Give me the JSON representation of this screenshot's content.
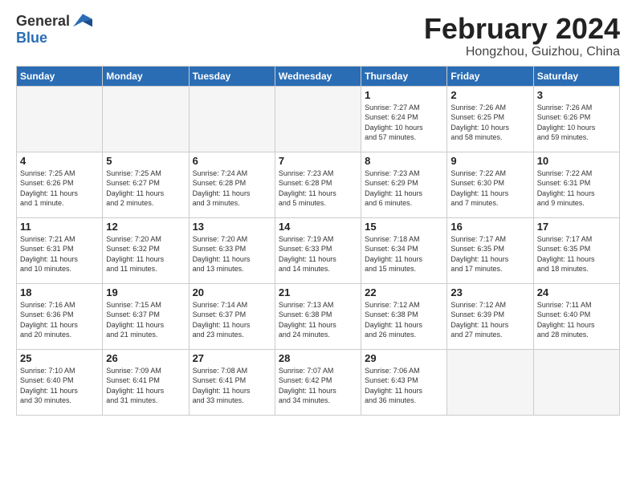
{
  "header": {
    "logo_general": "General",
    "logo_blue": "Blue",
    "month_title": "February 2024",
    "location": "Hongzhou, Guizhou, China"
  },
  "days_of_week": [
    "Sunday",
    "Monday",
    "Tuesday",
    "Wednesday",
    "Thursday",
    "Friday",
    "Saturday"
  ],
  "weeks": [
    [
      {
        "day": "",
        "info": ""
      },
      {
        "day": "",
        "info": ""
      },
      {
        "day": "",
        "info": ""
      },
      {
        "day": "",
        "info": ""
      },
      {
        "day": "1",
        "info": "Sunrise: 7:27 AM\nSunset: 6:24 PM\nDaylight: 10 hours\nand 57 minutes."
      },
      {
        "day": "2",
        "info": "Sunrise: 7:26 AM\nSunset: 6:25 PM\nDaylight: 10 hours\nand 58 minutes."
      },
      {
        "day": "3",
        "info": "Sunrise: 7:26 AM\nSunset: 6:26 PM\nDaylight: 10 hours\nand 59 minutes."
      }
    ],
    [
      {
        "day": "4",
        "info": "Sunrise: 7:25 AM\nSunset: 6:26 PM\nDaylight: 11 hours\nand 1 minute."
      },
      {
        "day": "5",
        "info": "Sunrise: 7:25 AM\nSunset: 6:27 PM\nDaylight: 11 hours\nand 2 minutes."
      },
      {
        "day": "6",
        "info": "Sunrise: 7:24 AM\nSunset: 6:28 PM\nDaylight: 11 hours\nand 3 minutes."
      },
      {
        "day": "7",
        "info": "Sunrise: 7:23 AM\nSunset: 6:28 PM\nDaylight: 11 hours\nand 5 minutes."
      },
      {
        "day": "8",
        "info": "Sunrise: 7:23 AM\nSunset: 6:29 PM\nDaylight: 11 hours\nand 6 minutes."
      },
      {
        "day": "9",
        "info": "Sunrise: 7:22 AM\nSunset: 6:30 PM\nDaylight: 11 hours\nand 7 minutes."
      },
      {
        "day": "10",
        "info": "Sunrise: 7:22 AM\nSunset: 6:31 PM\nDaylight: 11 hours\nand 9 minutes."
      }
    ],
    [
      {
        "day": "11",
        "info": "Sunrise: 7:21 AM\nSunset: 6:31 PM\nDaylight: 11 hours\nand 10 minutes."
      },
      {
        "day": "12",
        "info": "Sunrise: 7:20 AM\nSunset: 6:32 PM\nDaylight: 11 hours\nand 11 minutes."
      },
      {
        "day": "13",
        "info": "Sunrise: 7:20 AM\nSunset: 6:33 PM\nDaylight: 11 hours\nand 13 minutes."
      },
      {
        "day": "14",
        "info": "Sunrise: 7:19 AM\nSunset: 6:33 PM\nDaylight: 11 hours\nand 14 minutes."
      },
      {
        "day": "15",
        "info": "Sunrise: 7:18 AM\nSunset: 6:34 PM\nDaylight: 11 hours\nand 15 minutes."
      },
      {
        "day": "16",
        "info": "Sunrise: 7:17 AM\nSunset: 6:35 PM\nDaylight: 11 hours\nand 17 minutes."
      },
      {
        "day": "17",
        "info": "Sunrise: 7:17 AM\nSunset: 6:35 PM\nDaylight: 11 hours\nand 18 minutes."
      }
    ],
    [
      {
        "day": "18",
        "info": "Sunrise: 7:16 AM\nSunset: 6:36 PM\nDaylight: 11 hours\nand 20 minutes."
      },
      {
        "day": "19",
        "info": "Sunrise: 7:15 AM\nSunset: 6:37 PM\nDaylight: 11 hours\nand 21 minutes."
      },
      {
        "day": "20",
        "info": "Sunrise: 7:14 AM\nSunset: 6:37 PM\nDaylight: 11 hours\nand 23 minutes."
      },
      {
        "day": "21",
        "info": "Sunrise: 7:13 AM\nSunset: 6:38 PM\nDaylight: 11 hours\nand 24 minutes."
      },
      {
        "day": "22",
        "info": "Sunrise: 7:12 AM\nSunset: 6:38 PM\nDaylight: 11 hours\nand 26 minutes."
      },
      {
        "day": "23",
        "info": "Sunrise: 7:12 AM\nSunset: 6:39 PM\nDaylight: 11 hours\nand 27 minutes."
      },
      {
        "day": "24",
        "info": "Sunrise: 7:11 AM\nSunset: 6:40 PM\nDaylight: 11 hours\nand 28 minutes."
      }
    ],
    [
      {
        "day": "25",
        "info": "Sunrise: 7:10 AM\nSunset: 6:40 PM\nDaylight: 11 hours\nand 30 minutes."
      },
      {
        "day": "26",
        "info": "Sunrise: 7:09 AM\nSunset: 6:41 PM\nDaylight: 11 hours\nand 31 minutes."
      },
      {
        "day": "27",
        "info": "Sunrise: 7:08 AM\nSunset: 6:41 PM\nDaylight: 11 hours\nand 33 minutes."
      },
      {
        "day": "28",
        "info": "Sunrise: 7:07 AM\nSunset: 6:42 PM\nDaylight: 11 hours\nand 34 minutes."
      },
      {
        "day": "29",
        "info": "Sunrise: 7:06 AM\nSunset: 6:43 PM\nDaylight: 11 hours\nand 36 minutes."
      },
      {
        "day": "",
        "info": ""
      },
      {
        "day": "",
        "info": ""
      }
    ]
  ]
}
